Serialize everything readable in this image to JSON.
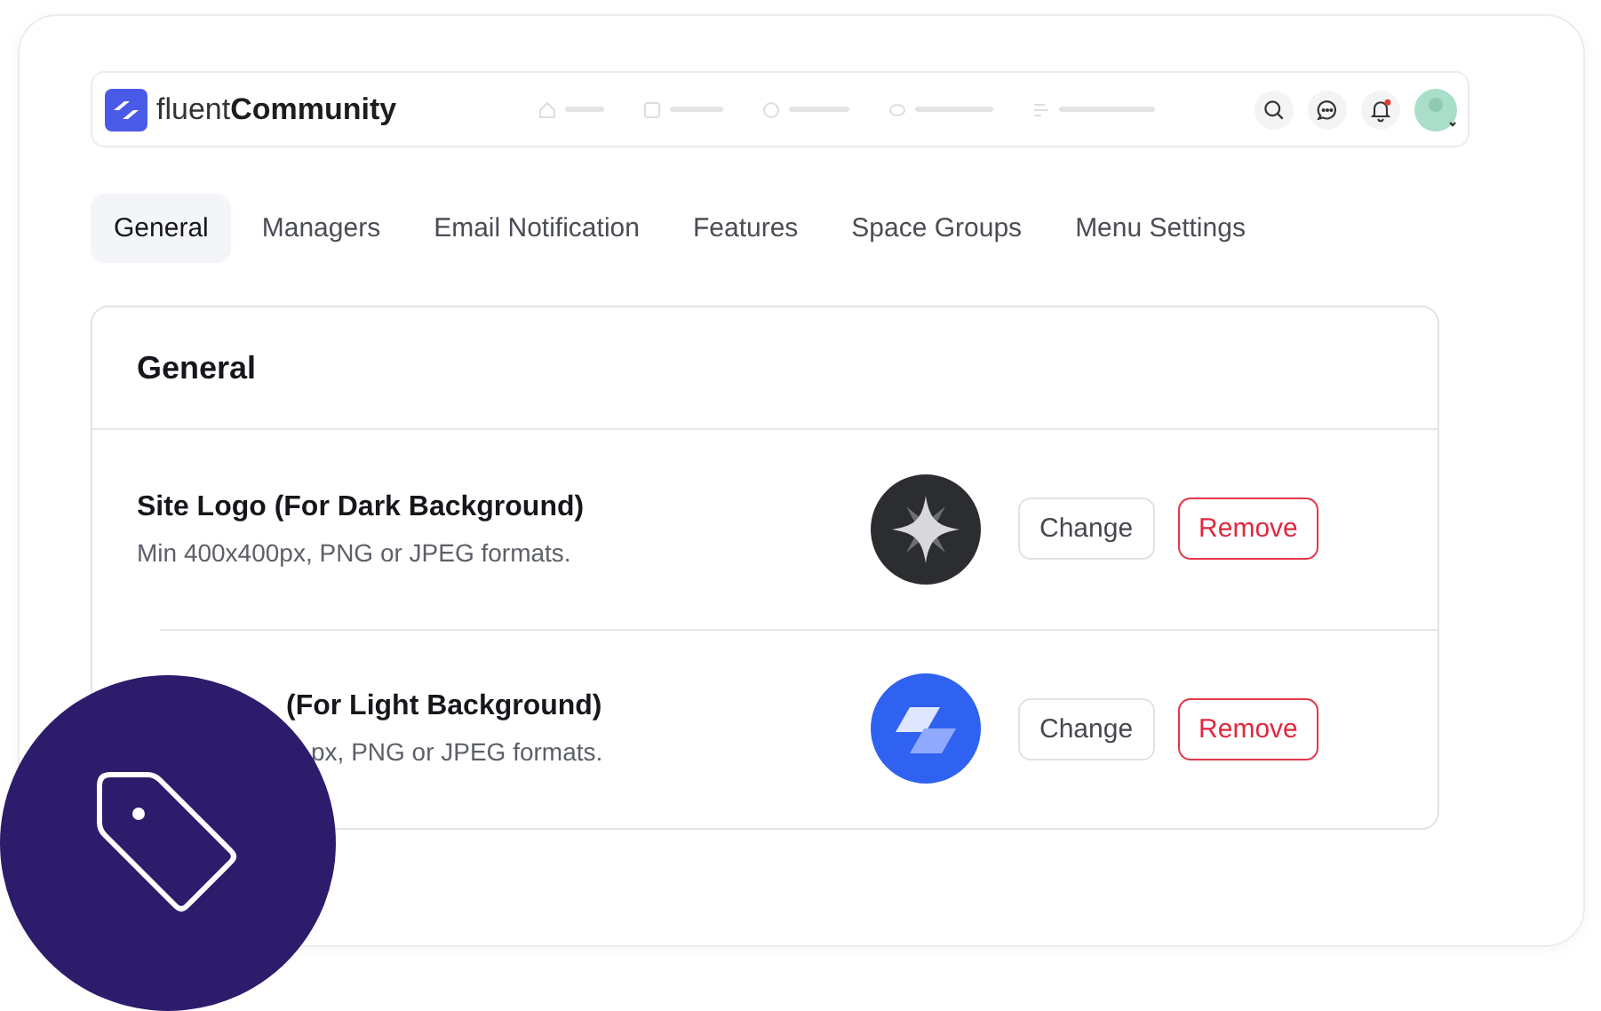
{
  "brand": {
    "light": "fluent",
    "bold": "Community"
  },
  "nav_placeholders": [
    {
      "kind": "home"
    },
    {
      "kind": "box"
    },
    {
      "kind": "circle"
    },
    {
      "kind": "eye"
    },
    {
      "kind": "list"
    }
  ],
  "header_icons": [
    {
      "kind": "search"
    },
    {
      "kind": "chat"
    },
    {
      "kind": "bell",
      "badge": true
    }
  ],
  "tabs": [
    {
      "label": "General",
      "selected": true
    },
    {
      "label": "Managers",
      "selected": false
    },
    {
      "label": "Email Notification",
      "selected": false
    },
    {
      "label": "Features",
      "selected": false
    },
    {
      "label": "Space Groups",
      "selected": false
    },
    {
      "label": "Menu Settings",
      "selected": false
    }
  ],
  "card": {
    "title": "General",
    "rows": [
      {
        "title": "Site Logo (For Dark Background)",
        "hint": "Min 400x400px, PNG or JPEG formats.",
        "logo": {
          "kind": "sparkle"
        },
        "covered": false,
        "buttons": [
          {
            "label": "Change",
            "kind": "neutral"
          },
          {
            "label": "Remove",
            "kind": "danger"
          }
        ]
      },
      {
        "title": "(For Light Background)",
        "hint": "px, PNG or JPEG formats.",
        "logo": {
          "kind": "layers"
        },
        "covered": true,
        "buttons": [
          {
            "label": "Change",
            "kind": "neutral"
          },
          {
            "label": "Remove",
            "kind": "danger"
          }
        ]
      }
    ]
  }
}
